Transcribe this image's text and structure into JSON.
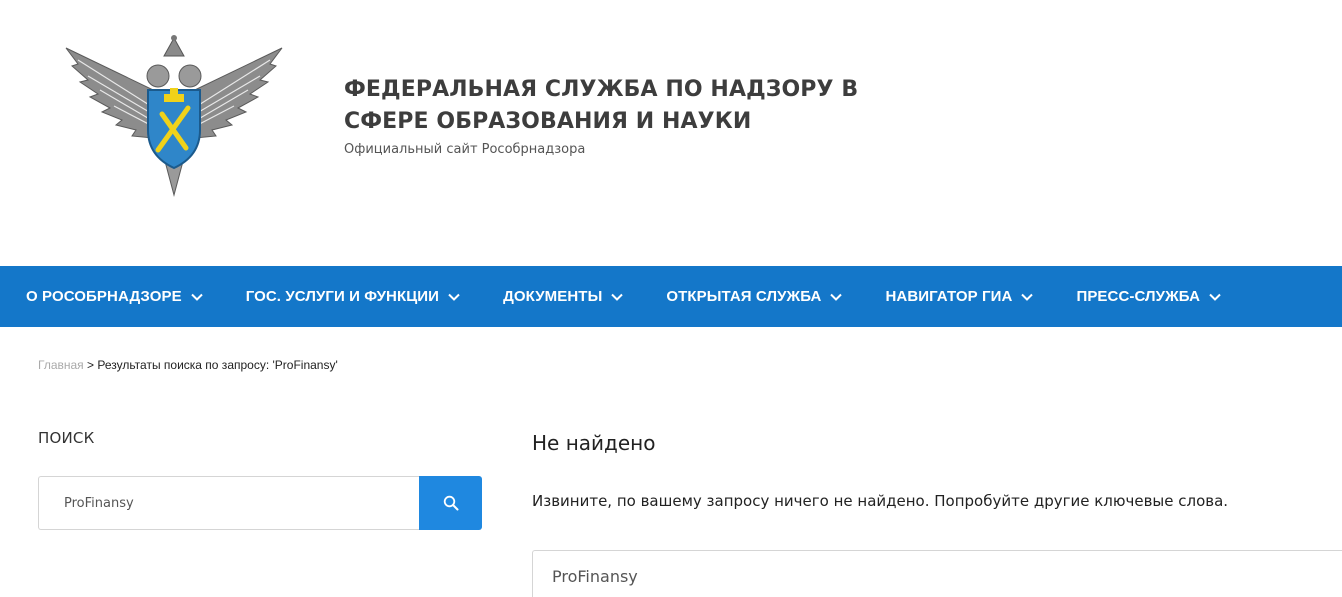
{
  "header": {
    "title": "ФЕДЕРАЛЬНАЯ СЛУЖБА ПО НАДЗОРУ В СФЕРЕ ОБРАЗОВАНИЯ И НАУКИ",
    "subtitle": "Официальный сайт Рособрнадзора",
    "logo_icon": "double-headed-eagle-emblem-icon"
  },
  "nav": {
    "items": [
      {
        "label": "О РОСОБРНАДЗОРЕ"
      },
      {
        "label": "ГОС. УСЛУГИ И ФУНКЦИИ"
      },
      {
        "label": "ДОКУМЕНТЫ"
      },
      {
        "label": "ОТКРЫТАЯ СЛУЖБА"
      },
      {
        "label": "НАВИГАТОР ГИА"
      },
      {
        "label": "ПРЕСС-СЛУЖБА"
      }
    ],
    "chevron_icon": "chevron-down-icon"
  },
  "breadcrumb": {
    "home": "Главная",
    "separator": " > ",
    "current": "Результаты поиска по запросу: 'ProFinansy'"
  },
  "sidebar": {
    "heading": "ПОИСК",
    "search_value": "ProFinansy",
    "search_icon": "search-icon"
  },
  "main": {
    "heading": "Не найдено",
    "message": "Извините, по вашему запросу ничего не найдено. Попробуйте другие ключевые слова.",
    "search_value": "ProFinansy"
  },
  "colors": {
    "nav_bg": "#1477c9",
    "search_button": "#1f88e0",
    "title": "#3d3d3d"
  }
}
